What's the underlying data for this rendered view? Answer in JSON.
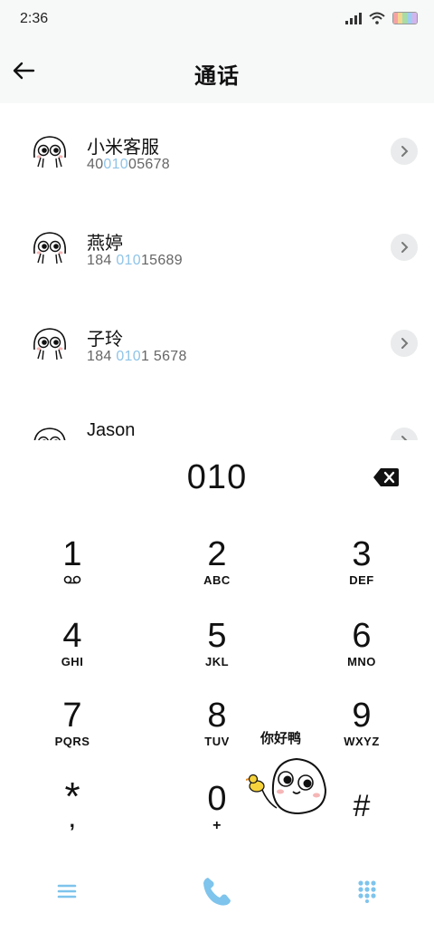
{
  "status_bar": {
    "time": "2:36",
    "icons": [
      "signal-icon",
      "wifi-icon",
      "battery-icon"
    ]
  },
  "header": {
    "title": "通话",
    "back_icon": "arrow-left-icon"
  },
  "contacts": [
    {
      "name": "小米客服",
      "number_parts": [
        "40",
        "010",
        "05678"
      ]
    },
    {
      "name": "燕婷",
      "number_parts": [
        "184 ",
        "010",
        "15689"
      ]
    },
    {
      "name": "子玲",
      "number_parts": [
        "184 ",
        "010",
        "1 5678"
      ]
    },
    {
      "name": "Jason",
      "number_parts": [
        "",
        "",
        ""
      ]
    }
  ],
  "dialer": {
    "input_value": "010",
    "keys": [
      {
        "digit": "1",
        "letters": ""
      },
      {
        "digit": "2",
        "letters": "ABC"
      },
      {
        "digit": "3",
        "letters": "DEF"
      },
      {
        "digit": "4",
        "letters": "GHI"
      },
      {
        "digit": "5",
        "letters": "JKL"
      },
      {
        "digit": "6",
        "letters": "MNO"
      },
      {
        "digit": "7",
        "letters": "PQRS"
      },
      {
        "digit": "8",
        "letters": "TUV"
      },
      {
        "digit": "9",
        "letters": "WXYZ"
      },
      {
        "digit": "*",
        "letters": ","
      },
      {
        "digit": "0",
        "letters": "+"
      },
      {
        "digit": "#",
        "letters": ""
      }
    ],
    "sticker_text": "你好鸭"
  },
  "bottom_bar": {
    "menu_icon": "menu-icon",
    "call_icon": "phone-icon",
    "keypad_icon": "keypad-icon"
  },
  "colors": {
    "accent": "#7ec4ec",
    "highlight": "#8fc4e8",
    "background": "#f7f9f8"
  }
}
